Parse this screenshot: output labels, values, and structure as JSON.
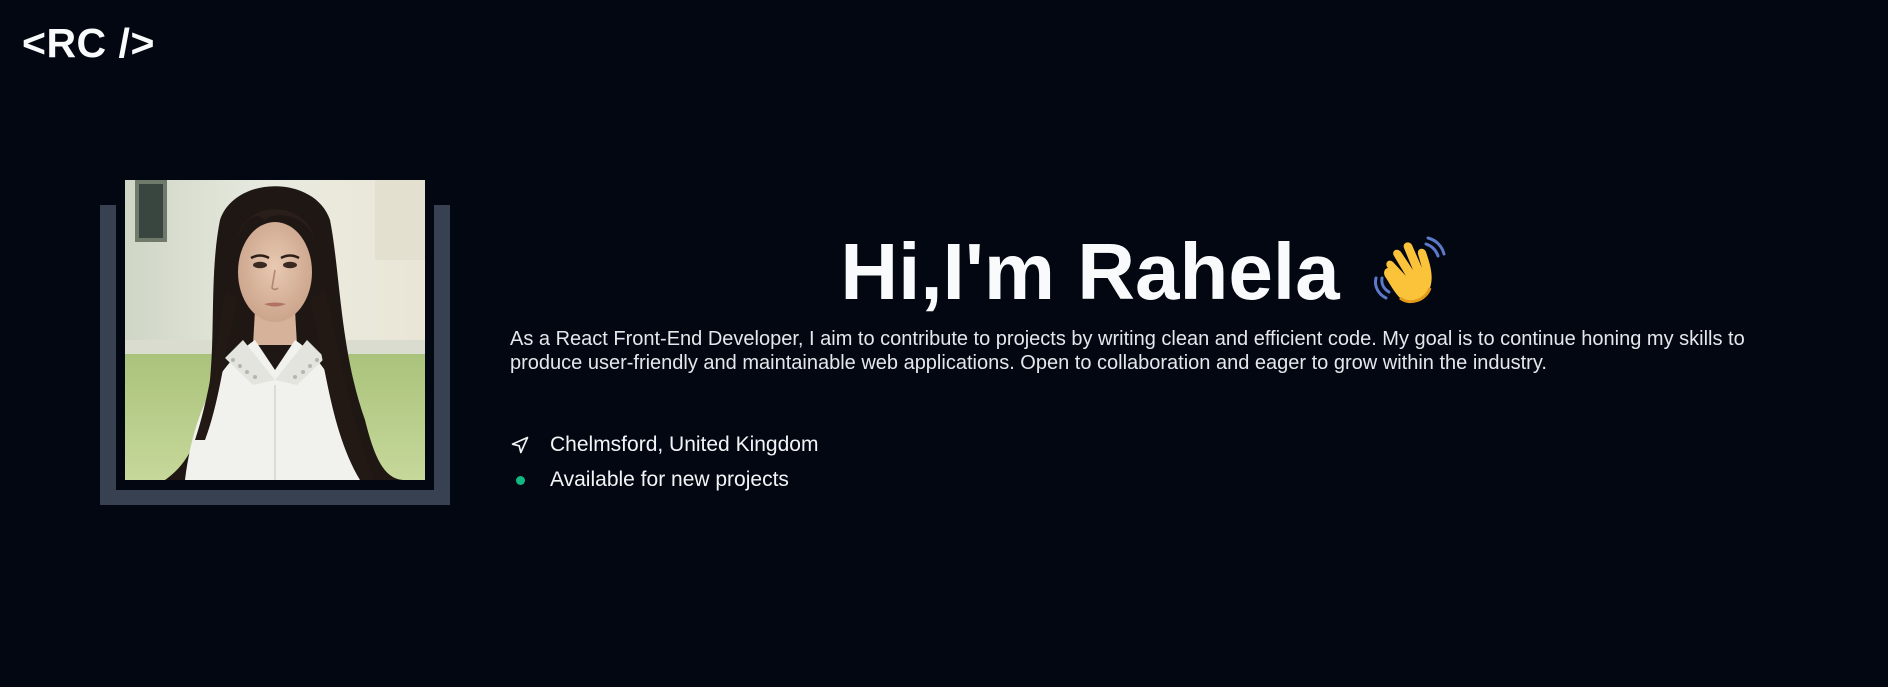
{
  "header": {
    "logo_text": "<RC />"
  },
  "hero": {
    "title": "Hi,I'm Rahela",
    "wave_icon": "waving-hand-icon",
    "description": "As a React Front-End Developer, I aim to contribute to projects by writing clean and efficient code. My goal is to continue honing my skills to produce user-friendly and maintainable web applications. Open to collaboration and eager to grow within the industry."
  },
  "info": {
    "location": "Chelmsford, United Kingdom",
    "location_icon": "navigation-arrow-icon",
    "availability": "Available for new projects",
    "availability_icon": "status-dot-icon",
    "availability_color": "#10b981"
  },
  "colors": {
    "background": "#030712",
    "frame": "#374151",
    "text": "#f9fafb"
  }
}
